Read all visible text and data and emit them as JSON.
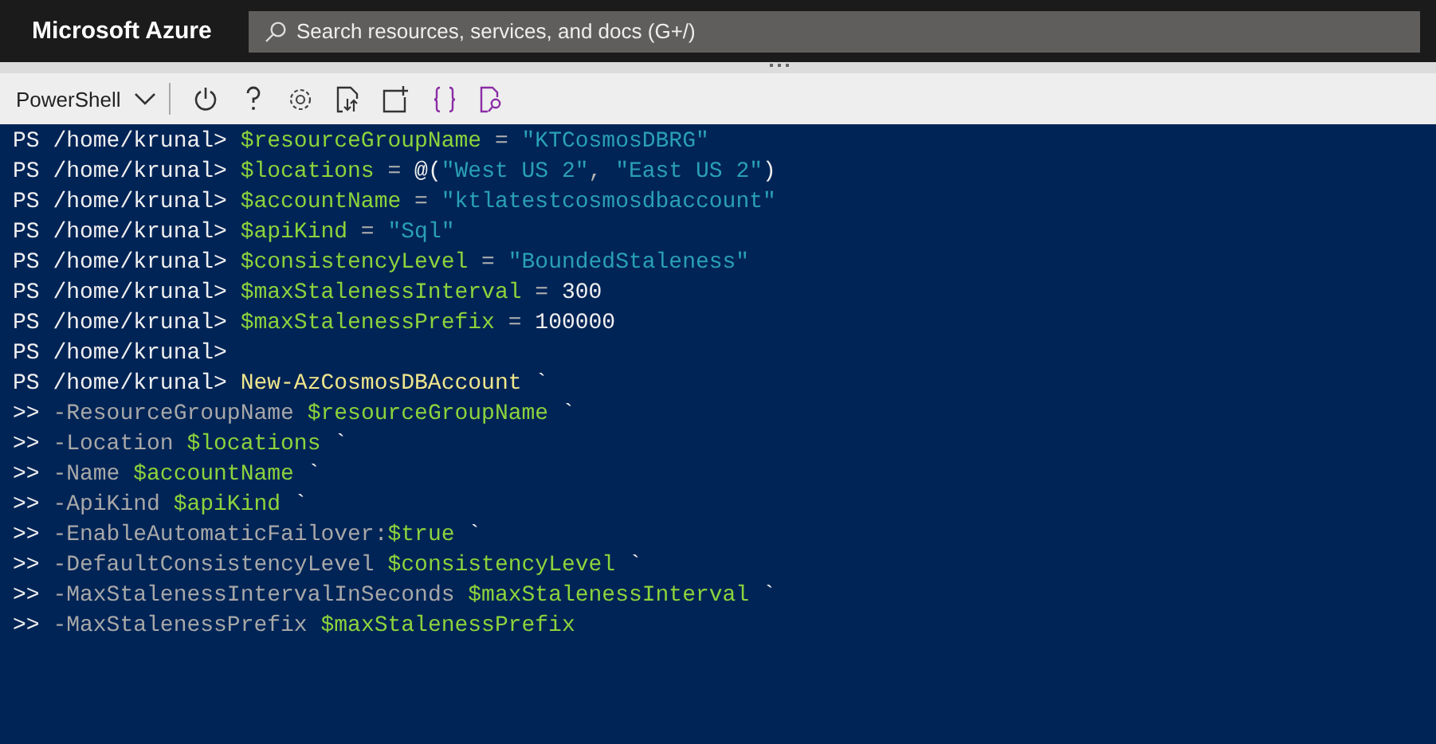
{
  "header": {
    "brand": "Microsoft Azure",
    "search": {
      "placeholder": "Search resources, services, and docs (G+/)"
    }
  },
  "toolbar": {
    "shell": "PowerShell",
    "tools": [
      {
        "kind": "power"
      },
      {
        "kind": "help"
      },
      {
        "kind": "settings"
      },
      {
        "kind": "upload"
      },
      {
        "kind": "new-session"
      },
      {
        "kind": "braces"
      },
      {
        "kind": "preview"
      }
    ]
  },
  "terminal": {
    "lines": [
      {
        "prompt": "PS /home/krunal>",
        "segments": [
          {
            "kind": "var",
            "text": "$resourceGroupName"
          },
          {
            "kind": "op",
            "text": " = "
          },
          {
            "kind": "string",
            "text": "\"KTCosmosDBRG\""
          }
        ]
      },
      {
        "prompt": "PS /home/krunal>",
        "segments": [
          {
            "kind": "var",
            "text": "$locations"
          },
          {
            "kind": "op",
            "text": " = "
          },
          {
            "kind": "plain",
            "text": "@("
          },
          {
            "kind": "string",
            "text": "\"West US 2\""
          },
          {
            "kind": "op",
            "text": ", "
          },
          {
            "kind": "string",
            "text": "\"East US 2\""
          },
          {
            "kind": "plain",
            "text": ")"
          }
        ]
      },
      {
        "prompt": "PS /home/krunal>",
        "segments": [
          {
            "kind": "var",
            "text": "$accountName"
          },
          {
            "kind": "op",
            "text": " = "
          },
          {
            "kind": "string",
            "text": "\"ktlatestcosmosdbaccount\""
          }
        ]
      },
      {
        "prompt": "PS /home/krunal>",
        "segments": [
          {
            "kind": "var",
            "text": "$apiKind"
          },
          {
            "kind": "op",
            "text": " = "
          },
          {
            "kind": "string",
            "text": "\"Sql\""
          }
        ]
      },
      {
        "prompt": "PS /home/krunal>",
        "segments": [
          {
            "kind": "var",
            "text": "$consistencyLevel"
          },
          {
            "kind": "op",
            "text": " = "
          },
          {
            "kind": "string",
            "text": "\"BoundedStaleness\""
          }
        ]
      },
      {
        "prompt": "PS /home/krunal>",
        "segments": [
          {
            "kind": "var",
            "text": "$maxStalenessInterval"
          },
          {
            "kind": "op",
            "text": " = "
          },
          {
            "kind": "plain",
            "text": "300"
          }
        ]
      },
      {
        "prompt": "PS /home/krunal>",
        "segments": [
          {
            "kind": "var",
            "text": "$maxStalenessPrefix"
          },
          {
            "kind": "op",
            "text": " = "
          },
          {
            "kind": "plain",
            "text": "100000"
          }
        ]
      },
      {
        "prompt": "PS /home/krunal>"
      },
      {
        "prompt": "PS /home/krunal>",
        "segments": [
          {
            "kind": "cmd",
            "text": "New-AzCosmosDBAccount"
          },
          {
            "kind": "plain",
            "text": " `"
          }
        ]
      },
      {
        "prompt": ">>",
        "segments": [
          {
            "kind": "param",
            "text": "-ResourceGroupName "
          },
          {
            "kind": "var",
            "text": "$resourceGroupName"
          },
          {
            "kind": "plain",
            "text": " `"
          }
        ]
      },
      {
        "prompt": ">>",
        "segments": [
          {
            "kind": "param",
            "text": "-Location "
          },
          {
            "kind": "var",
            "text": "$locations"
          },
          {
            "kind": "plain",
            "text": " `"
          }
        ]
      },
      {
        "prompt": ">>",
        "segments": [
          {
            "kind": "param",
            "text": "-Name "
          },
          {
            "kind": "var",
            "text": "$accountName"
          },
          {
            "kind": "plain",
            "text": " `"
          }
        ]
      },
      {
        "prompt": ">>",
        "segments": [
          {
            "kind": "param",
            "text": "-ApiKind "
          },
          {
            "kind": "var",
            "text": "$apiKind"
          },
          {
            "kind": "plain",
            "text": " `"
          }
        ]
      },
      {
        "prompt": ">>",
        "segments": [
          {
            "kind": "param",
            "text": "-EnableAutomaticFailover:"
          },
          {
            "kind": "var",
            "text": "$true"
          },
          {
            "kind": "plain",
            "text": " `"
          }
        ]
      },
      {
        "prompt": ">>",
        "segments": [
          {
            "kind": "param",
            "text": "-DefaultConsistencyLevel "
          },
          {
            "kind": "var",
            "text": "$consistencyLevel"
          },
          {
            "kind": "plain",
            "text": " `"
          }
        ]
      },
      {
        "prompt": ">>",
        "segments": [
          {
            "kind": "param",
            "text": "-MaxStalenessIntervalInSeconds "
          },
          {
            "kind": "var",
            "text": "$maxStalenessInterval"
          },
          {
            "kind": "plain",
            "text": " `"
          }
        ]
      },
      {
        "prompt": ">>",
        "segments": [
          {
            "kind": "param",
            "text": "-MaxStalenessPrefix "
          },
          {
            "kind": "var",
            "text": "$maxStalenessPrefix"
          }
        ]
      }
    ]
  }
}
